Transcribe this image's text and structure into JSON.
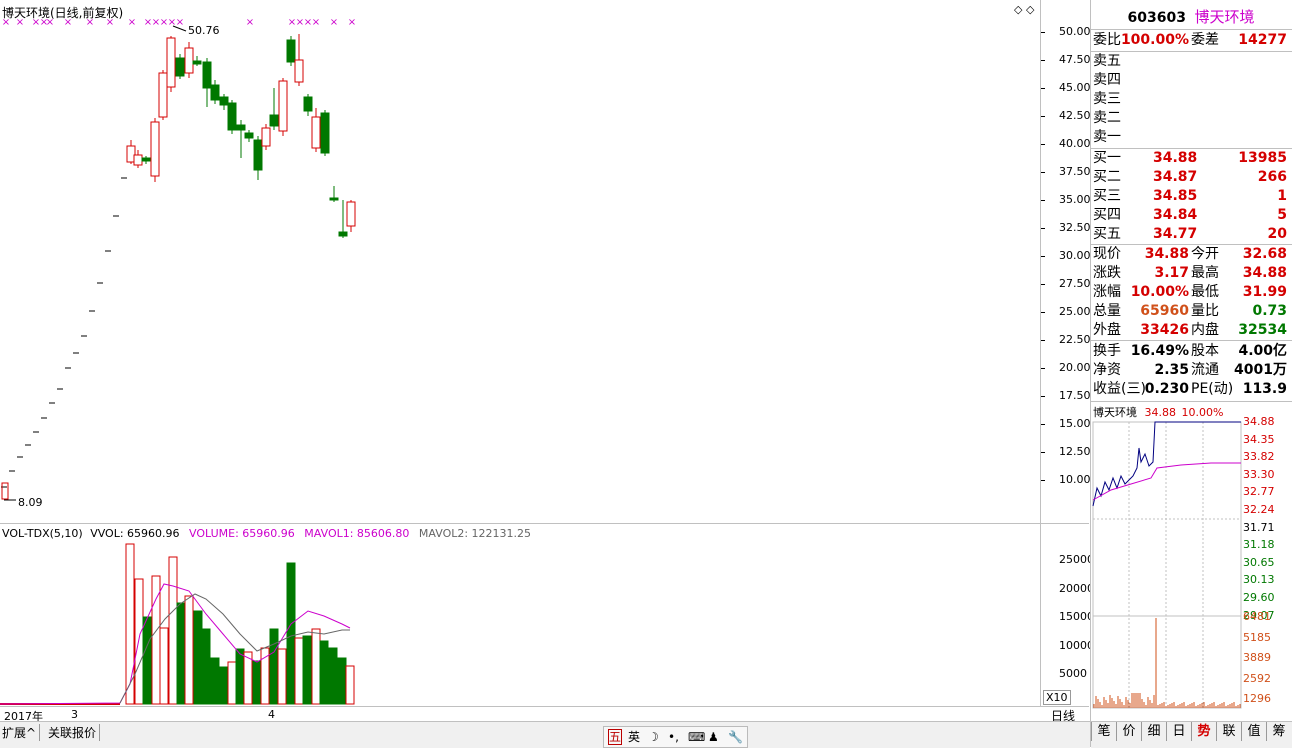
{
  "main_chart": {
    "title": "博天环境(日线,前复权)",
    "high_marker": "50.76",
    "low_marker": "8.09",
    "y_ticks": [
      "50.00",
      "47.50",
      "45.00",
      "42.50",
      "40.00",
      "37.50",
      "35.00",
      "32.50",
      "30.00",
      "27.50",
      "25.00",
      "22.50",
      "20.00",
      "17.50",
      "15.00",
      "12.50",
      "10.00"
    ]
  },
  "volume_chart": {
    "indicator": "VOL-TDX(5,10)",
    "vvol": "VVOL: 65960.96",
    "volume": "VOLUME: 65960.96",
    "mavol1": "MAVOL1: 85606.80",
    "mavol2": "MAVOL2: 122131.25",
    "y_ticks": [
      "25000",
      "20000",
      "15000",
      "10000",
      "5000"
    ],
    "multiplier": "X10"
  },
  "x_axis": {
    "labels": [
      "2017年",
      "3",
      "4"
    ],
    "period": "日线"
  },
  "bottom_tabs": {
    "expand": "扩展^",
    "related": "关联报价"
  },
  "ime": {
    "items": [
      "五",
      "英",
      "☽",
      "•,",
      "⌨",
      "♟",
      "🔧"
    ]
  },
  "quote": {
    "code": "603603",
    "name": "博天环境",
    "weibi_label": "委比",
    "weibi_value": "100.00%",
    "weicha_label": "委差",
    "weicha_value": "14277",
    "sell": [
      {
        "label": "卖五",
        "price": "",
        "vol": ""
      },
      {
        "label": "卖四",
        "price": "",
        "vol": ""
      },
      {
        "label": "卖三",
        "price": "",
        "vol": ""
      },
      {
        "label": "卖二",
        "price": "",
        "vol": ""
      },
      {
        "label": "卖一",
        "price": "",
        "vol": ""
      }
    ],
    "buy": [
      {
        "label": "买一",
        "price": "34.88",
        "vol": "13985"
      },
      {
        "label": "买二",
        "price": "34.87",
        "vol": "266"
      },
      {
        "label": "买三",
        "price": "34.85",
        "vol": "1"
      },
      {
        "label": "买四",
        "price": "34.84",
        "vol": "5"
      },
      {
        "label": "买五",
        "price": "34.77",
        "vol": "20"
      }
    ],
    "stats": [
      {
        "l1": "现价",
        "v1": "34.88",
        "c1": "red",
        "l2": "今开",
        "v2": "32.68",
        "c2": "red"
      },
      {
        "l1": "涨跌",
        "v1": "3.17",
        "c1": "red",
        "l2": "最高",
        "v2": "34.88",
        "c2": "red"
      },
      {
        "l1": "涨幅",
        "v1": "10.00%",
        "c1": "red",
        "l2": "最低",
        "v2": "31.99",
        "c2": "red"
      },
      {
        "l1": "总量",
        "v1": "65960",
        "c1": "orange",
        "l2": "量比",
        "v2": "0.73",
        "c2": "green"
      },
      {
        "l1": "外盘",
        "v1": "33426",
        "c1": "red",
        "l2": "内盘",
        "v2": "32534",
        "c2": "green"
      }
    ],
    "finance": [
      {
        "l1": "换手",
        "v1": "16.49%",
        "l2": "股本",
        "v2": "4.00亿"
      },
      {
        "l1": "净资",
        "v1": "2.35",
        "l2": "流通",
        "v2": "4001万"
      },
      {
        "l1": "收益(三)",
        "v1": "0.230",
        "l2": "PE(动)",
        "v2": "113.9"
      }
    ]
  },
  "mini_chart": {
    "name": "博天环境",
    "price": "34.88",
    "pct": "10.00%",
    "price_ticks": [
      "34.88",
      "34.35",
      "33.82",
      "33.30",
      "32.77",
      "32.24",
      "31.71",
      "31.18",
      "30.65",
      "30.13",
      "29.60",
      "29.07"
    ],
    "vol_ticks": [
      "6481",
      "5185",
      "3889",
      "2592",
      "1296"
    ]
  },
  "right_tabs": [
    "笔",
    "价",
    "细",
    "日",
    "势",
    "联",
    "值",
    "筹"
  ],
  "colors": {
    "up": "#d40000",
    "down": "#007800",
    "ma1": "#cc00cc",
    "ma2": "#000000",
    "accent": "#cc00cc"
  }
}
